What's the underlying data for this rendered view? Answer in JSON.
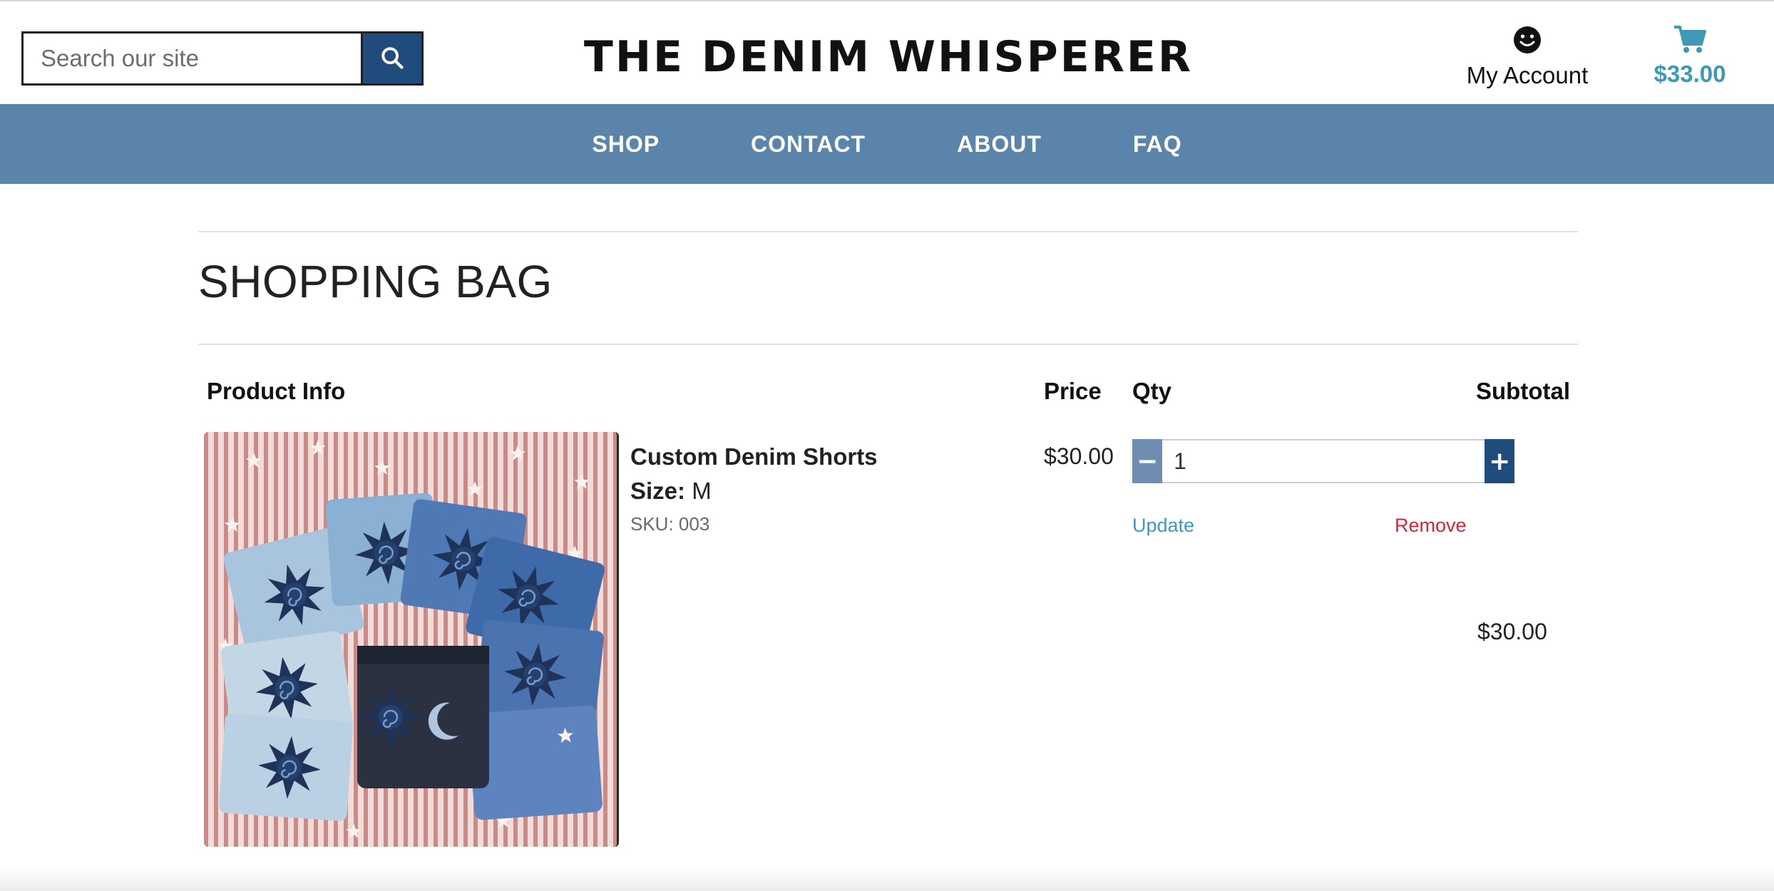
{
  "header": {
    "search_placeholder": "Search our site",
    "logo_text": "THE DENIM WHISPERER",
    "account_label": "My Account",
    "cart_total": "$33.00",
    "icons": {
      "search": "search-icon",
      "account": "smiley-icon",
      "cart": "shopping-cart-icon"
    }
  },
  "nav": {
    "items": [
      {
        "label": "SHOP"
      },
      {
        "label": "CONTACT"
      },
      {
        "label": "ABOUT"
      },
      {
        "label": "FAQ"
      }
    ]
  },
  "page": {
    "title": "SHOPPING BAG"
  },
  "table": {
    "headers": {
      "product_info": "Product Info",
      "price": "Price",
      "qty": "Qty",
      "subtotal": "Subtotal"
    },
    "items": [
      {
        "name": "Custom Denim Shorts",
        "size_label": "Size:",
        "size_value": "M",
        "sku": "SKU: 003",
        "price": "$30.00",
        "qty": "1",
        "minus_label": "−",
        "plus_label": "+",
        "update_label": "Update",
        "remove_label": "Remove",
        "subtotal": "$30.00"
      }
    ]
  },
  "colors": {
    "nav_bg": "#5b84aa",
    "brand_dark": "#204b7d",
    "accent_teal": "#3d99b6",
    "remove_red": "#d0273a"
  }
}
